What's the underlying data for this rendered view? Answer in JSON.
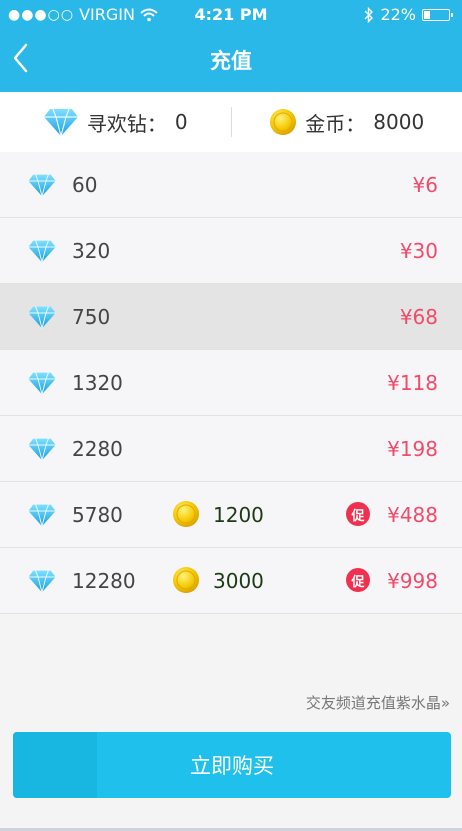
{
  "status_bar": {
    "carrier": "VIRGIN",
    "time": "4:21 PM",
    "battery": "22%",
    "battery_level": 0.22
  },
  "header": {
    "title": "充值"
  },
  "balance": {
    "diamond_label": "寻欢钻：",
    "diamond_value": "0",
    "coin_label": "金币：",
    "coin_value": "8000"
  },
  "packages": [
    {
      "amount": "60",
      "price": "¥6"
    },
    {
      "amount": "320",
      "price": "¥30"
    },
    {
      "amount": "750",
      "price": "¥68",
      "selected": true
    },
    {
      "amount": "1320",
      "price": "¥118"
    },
    {
      "amount": "2280",
      "price": "¥198"
    },
    {
      "amount": "5780",
      "bonus": "1200",
      "promo": "促",
      "price": "¥488"
    },
    {
      "amount": "12280",
      "bonus": "3000",
      "promo": "促",
      "price": "¥998"
    }
  ],
  "footer": {
    "link_text": "交友频道充值紫水晶»",
    "buy_label": "立即购买"
  },
  "colors": {
    "accent": "#29b8e8",
    "price": "#f24b6a",
    "promo": "#f0304f",
    "bonus_text": "#1d3a14"
  },
  "icons": [
    "back-chevron-icon",
    "diamond-icon",
    "coin-icon",
    "wifi-icon",
    "bluetooth-icon",
    "battery-icon"
  ]
}
